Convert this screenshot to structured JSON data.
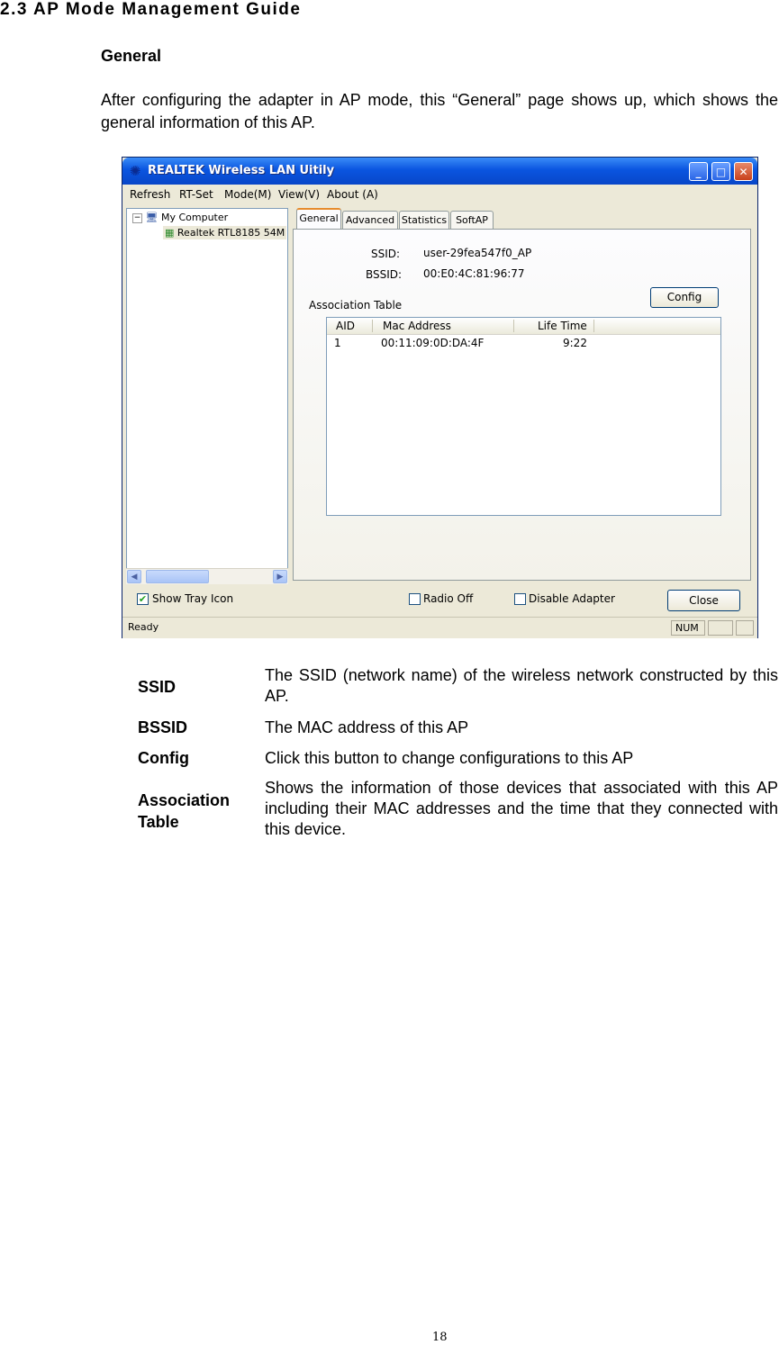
{
  "doc": {
    "heading": "2.3 AP Mode Management Guide",
    "subheading": "General",
    "intro": "After configuring the adapter in AP mode, this “General” page shows up, which shows the general information of this AP.",
    "page_number": "18"
  },
  "window": {
    "title": "REALTEK Wireless LAN Uitily",
    "title_buttons": {
      "minimize": "_",
      "maximize": "□",
      "close": "✕"
    },
    "menu": [
      "Refresh",
      "RT-Set",
      "Mode(M)",
      "View(V)",
      "About (A)"
    ],
    "tree": {
      "root": "My Computer",
      "child": "Realtek RTL8185 54M"
    },
    "tabs": [
      "General",
      "Advanced",
      "Statistics",
      "SoftAP"
    ],
    "general": {
      "ssid_label": "SSID:",
      "ssid_value": "user-29fea547f0_AP",
      "bssid_label": "BSSID:",
      "bssid_value": "00:E0:4C:81:96:77",
      "assoc_title": "Association Table",
      "config_button": "Config",
      "columns": [
        "AID",
        "Mac Address",
        "Life Time"
      ],
      "rows": [
        {
          "aid": "1",
          "mac": "00:11:09:0D:DA:4F",
          "life": "9:22"
        }
      ]
    },
    "bottom": {
      "show_tray": "Show Tray Icon",
      "radio_off": "Radio Off",
      "disable_adapter": "Disable Adapter",
      "close_button": "Close"
    },
    "status": {
      "text": "Ready",
      "num": "NUM"
    }
  },
  "definitions": [
    {
      "term": "SSID",
      "desc": "The SSID (network name) of the wireless network constructed by this AP."
    },
    {
      "term": "BSSID",
      "desc": "The MAC address of this AP"
    },
    {
      "term": "Config",
      "desc": "Click this button to change configurations to this AP"
    },
    {
      "term": "Association Table",
      "desc": "Shows the information of those devices that associated with this AP including their MAC addresses and the time that they connected with this device."
    }
  ]
}
